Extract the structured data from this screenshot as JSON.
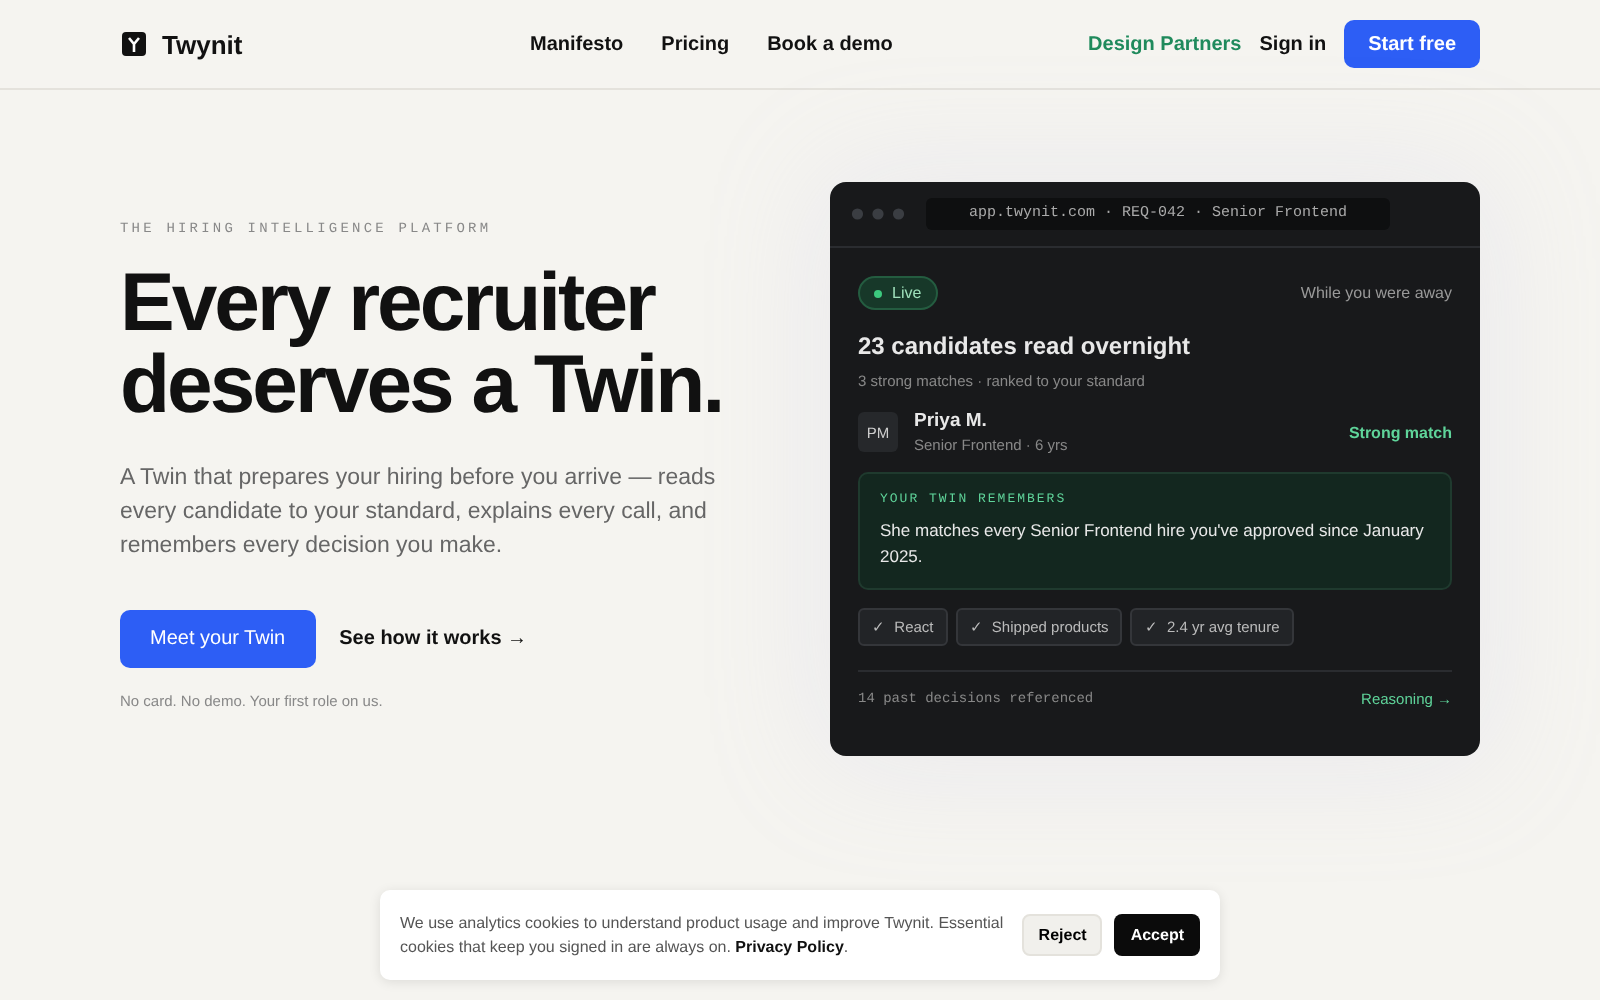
{
  "header": {
    "logo": "Twynit",
    "nav": [
      "Manifesto",
      "Pricing",
      "Book a demo"
    ],
    "partners": "Design Partners",
    "sign_in": "Sign in",
    "cta": "Start free"
  },
  "hero": {
    "eyebrow": "THE HIRING INTELLIGENCE PLATFORM",
    "title_lines": [
      "Every recruiter",
      "deserves a Twin."
    ],
    "lede": "A Twin that prepares your hiring before you arrive — reads every candidate to your standard, explains every call, and remembers every decision you make.",
    "primary": "Meet your Twin",
    "secondary": "See how it works",
    "secondary_arrow": "→",
    "note": "No card. No demo. Your first role on us."
  },
  "preview": {
    "url": "app.twynit.com · REQ-042 · Senior Frontend",
    "status": "Live",
    "away": "While you were away",
    "headline": "23 candidates read overnight",
    "subline": "3 strong matches · ranked to your standard",
    "candidate": {
      "initials": "PM",
      "name": "Priya M.",
      "role": "Senior Frontend · 6 yrs",
      "match": "Strong match"
    },
    "memory": {
      "label": "YOUR TWIN REMEMBERS",
      "text": "She matches every Senior Frontend hire you've approved since January 2025."
    },
    "tags": [
      {
        "check": "✓",
        "label": "React"
      },
      {
        "check": "✓",
        "label": "Shipped products"
      },
      {
        "check": "✓",
        "label": "2.4 yr avg tenure"
      }
    ],
    "footer": "14 past decisions referenced",
    "reasoning": "Reasoning →"
  },
  "cookie": {
    "text": "We use analytics cookies to understand product usage and improve Twynit. Essential cookies that keep you signed in are always on.",
    "link": "Privacy Policy",
    "link_suffix": ".",
    "reject": "Reject",
    "accept": "Accept"
  }
}
